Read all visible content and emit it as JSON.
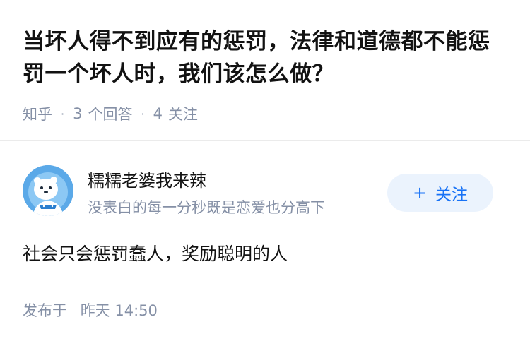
{
  "question": {
    "title": "当坏人得不到应有的惩罚，法律和道德都不能惩罚一个坏人时，我们该怎么做？",
    "source": "知乎",
    "answer_count": "3",
    "answer_label": "个回答",
    "follower_count": "4",
    "follower_label": "关注"
  },
  "author": {
    "name": "糯糯老婆我来辣",
    "bio": "没表白的每一分秒既是恋爱也分高下",
    "follow_label": "关注",
    "avatar_icon": "cartoon-polar-bear-avatar"
  },
  "answer": {
    "text": "社会只会惩罚蠢人，奖励聪明的人",
    "posted_prefix": "发布于",
    "posted_time": "昨天 14:50"
  },
  "colors": {
    "primary_text": "#121212",
    "secondary_text": "#8590a6",
    "accent": "#1772f6",
    "follow_bg": "#ebf3fd"
  }
}
